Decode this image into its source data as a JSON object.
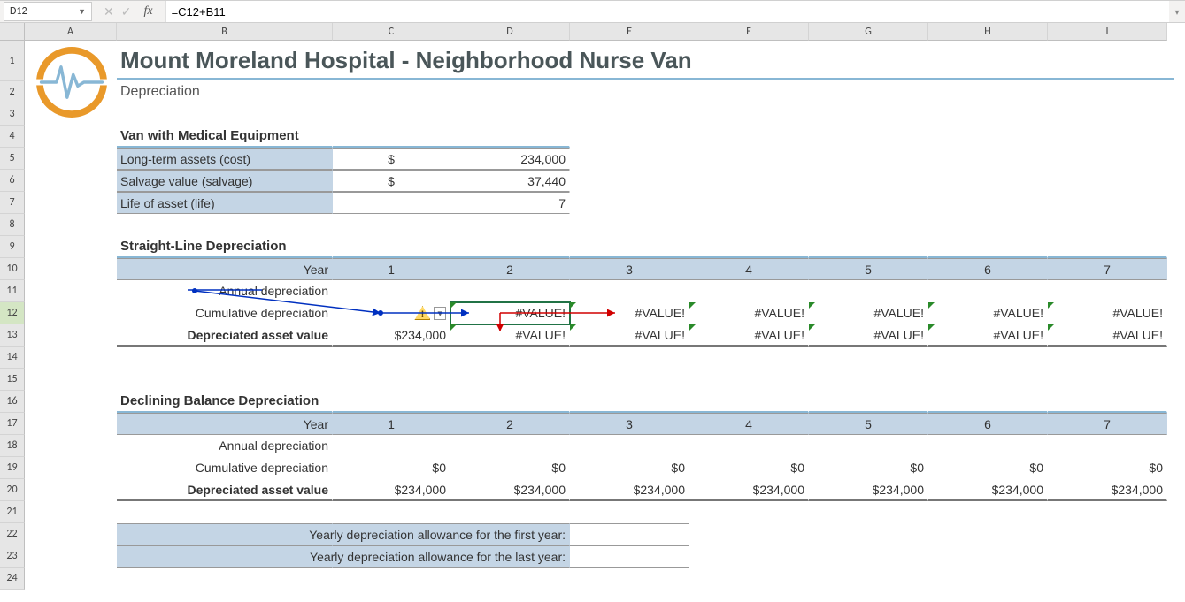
{
  "namebox": "D12",
  "formula": "=C12+B11",
  "columns": [
    "A",
    "B",
    "C",
    "D",
    "E",
    "F",
    "G",
    "H",
    "I"
  ],
  "rows_visible": 24,
  "title": "Mount Moreland Hospital - Neighborhood Nurse Van",
  "subtitle": "Depreciation",
  "sections": {
    "assets": {
      "header": "Van with Medical Equipment",
      "rows": [
        {
          "label": "Long-term assets (cost)",
          "cur": "$",
          "val": "234,000"
        },
        {
          "label": "Salvage value (salvage)",
          "cur": "$",
          "val": "37,440"
        },
        {
          "label": "Life of asset (life)",
          "cur": "",
          "val": "7"
        }
      ]
    },
    "sld": {
      "header": "Straight-Line Depreciation",
      "year_label": "Year",
      "years": [
        "1",
        "2",
        "3",
        "4",
        "5",
        "6",
        "7"
      ],
      "rows": [
        {
          "label": "Annual depreciation",
          "vals": [
            "",
            "",
            "",
            "",
            "",
            "",
            ""
          ]
        },
        {
          "label": "Cumulative depreciation",
          "vals": [
            "",
            "#VALUE!",
            "#VALUE!",
            "#VALUE!",
            "#VALUE!",
            "#VALUE!",
            "#VALUE!"
          ],
          "flags": [
            0,
            1,
            1,
            1,
            1,
            1,
            1
          ],
          "warn": true,
          "selected_col": 2
        },
        {
          "label": "Depreciated asset value",
          "vals": [
            "$234,000",
            "#VALUE!",
            "#VALUE!",
            "#VALUE!",
            "#VALUE!",
            "#VALUE!",
            "#VALUE!"
          ],
          "flags": [
            0,
            1,
            1,
            1,
            1,
            1,
            1
          ],
          "bold": true
        }
      ]
    },
    "dbd": {
      "header": "Declining Balance Depreciation",
      "year_label": "Year",
      "years": [
        "1",
        "2",
        "3",
        "4",
        "5",
        "6",
        "7"
      ],
      "rows": [
        {
          "label": "Annual depreciation",
          "vals": [
            "",
            "",
            "",
            "",
            "",
            "",
            ""
          ]
        },
        {
          "label": "Cumulative depreciation",
          "vals": [
            "$0",
            "$0",
            "$0",
            "$0",
            "$0",
            "$0",
            "$0"
          ]
        },
        {
          "label": "Depreciated asset value",
          "vals": [
            "$234,000",
            "$234,000",
            "$234,000",
            "$234,000",
            "$234,000",
            "$234,000",
            "$234,000"
          ],
          "bold": true
        }
      ]
    },
    "alloc": [
      "Yearly depreciation allowance for the first year:",
      "Yearly depreciation allowance for the last year:"
    ]
  }
}
